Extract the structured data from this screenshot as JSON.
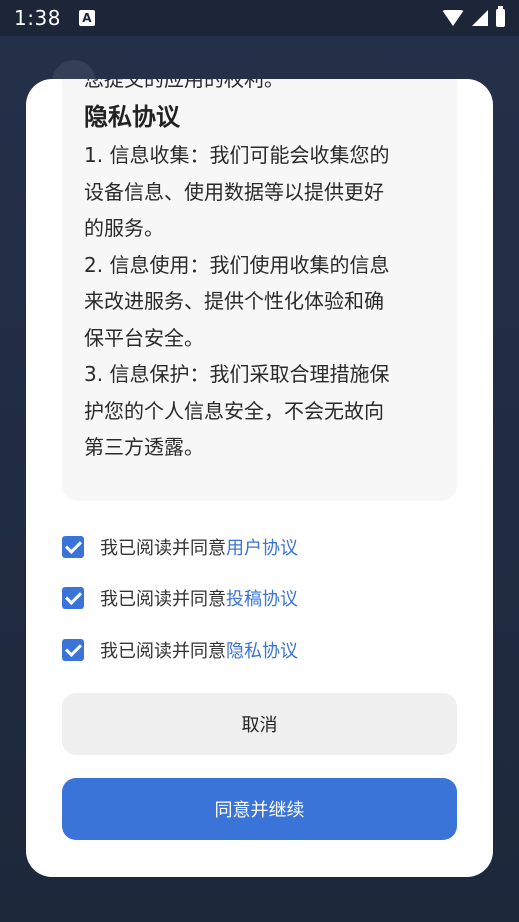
{
  "status_bar": {
    "time": "1:38",
    "app_icon_glyph": "A"
  },
  "content": {
    "cut_line": "您提交的应用的权利。",
    "privacy_title": "隐私协议",
    "paragraphs": [
      [
        "1. 信息收集：我们可能会收集您的",
        "设备信息、使用数据等以提供更好",
        "的服务。"
      ],
      [
        "2. 信息使用：我们使用收集的信息",
        "来改进服务、提供个性化体验和确",
        "保平台安全。"
      ],
      [
        "3. 信息保护：我们采取合理措施保",
        "护您的个人信息安全，不会无故向",
        "第三方透露。"
      ]
    ]
  },
  "agreements": [
    {
      "prefix": "我已阅读并同意",
      "link": "用户协议",
      "checked": true
    },
    {
      "prefix": "我已阅读并同意",
      "link": "投稿协议",
      "checked": true
    },
    {
      "prefix": "我已阅读并同意",
      "link": "隐私协议",
      "checked": true
    }
  ],
  "buttons": {
    "cancel": "取消",
    "agree": "同意并继续"
  },
  "colors": {
    "accent": "#3a74d8",
    "background": "#1f2a3d",
    "cancel_bg": "#efefef"
  }
}
